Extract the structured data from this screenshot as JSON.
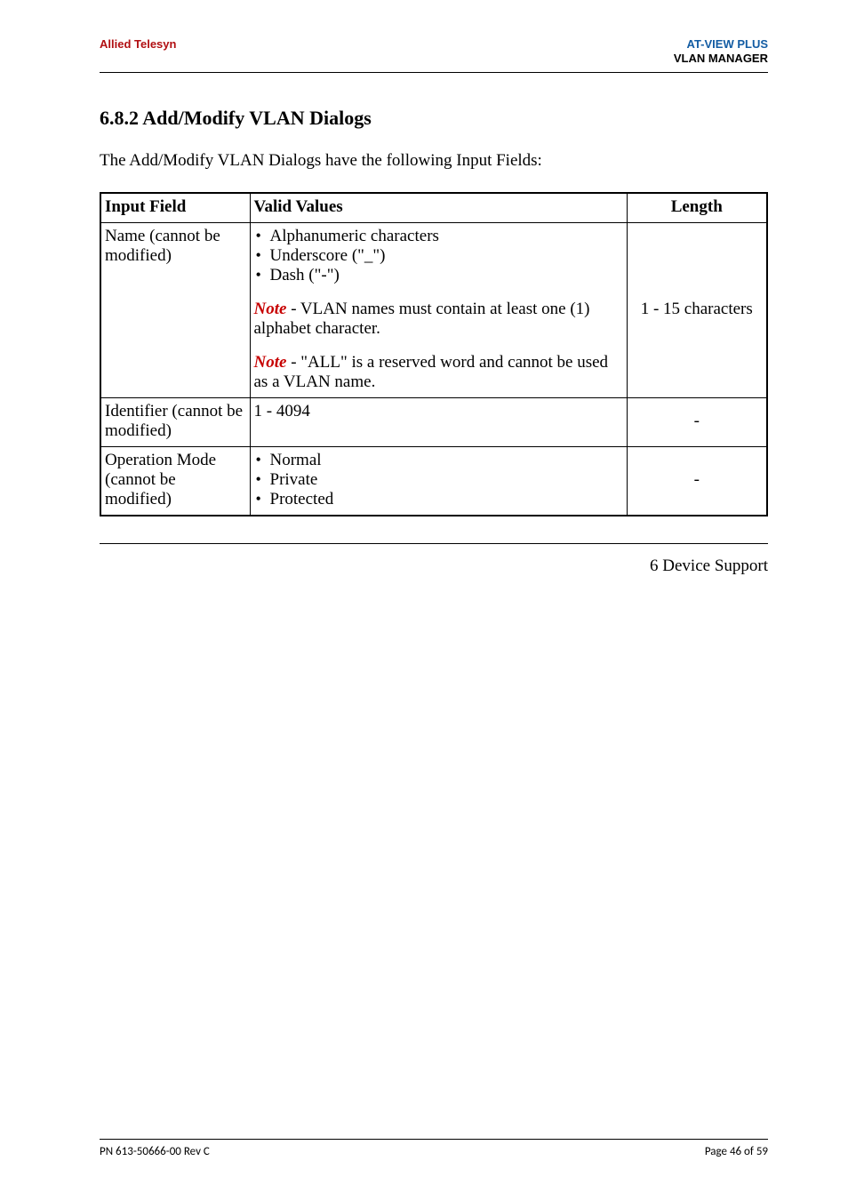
{
  "header": {
    "brand_left": "Allied Telesyn",
    "brand_right_line1": "AT-VIEW PLUS",
    "brand_right_line2": "VLAN MANAGER"
  },
  "section": {
    "title": "6.8.2 Add/Modify VLAN Dialogs",
    "intro": "The Add/Modify VLAN Dialogs have the following Input Fields:"
  },
  "table": {
    "headers": {
      "c1": "Input Field",
      "c2": "Valid Values",
      "c3": "Length"
    },
    "row1": {
      "field": "Name (cannot be modified)",
      "bullets": [
        "Alphanumeric characters",
        "Underscore (\"_\")",
        "Dash (\"-\")"
      ],
      "note1_prefix": "Note",
      "note1_rest": " - VLAN names must contain at least one (1) alphabet character.",
      "note2_prefix": "Note",
      "note2_rest": " - \"ALL\" is a reserved word and cannot be used as a VLAN name.",
      "length": "1 - 15 characters"
    },
    "row2": {
      "field": "Identifier (cannot be modified)",
      "value": "1 - 4094",
      "length": "-"
    },
    "row3": {
      "field": "Operation Mode (cannot be modified)",
      "bullets": [
        "Normal",
        "Private",
        "Protected"
      ],
      "length": "-"
    }
  },
  "nav_right": "6 Device Support",
  "footer": {
    "left": "PN 613-50666-00 Rev C",
    "right": "Page 46 of 59"
  }
}
